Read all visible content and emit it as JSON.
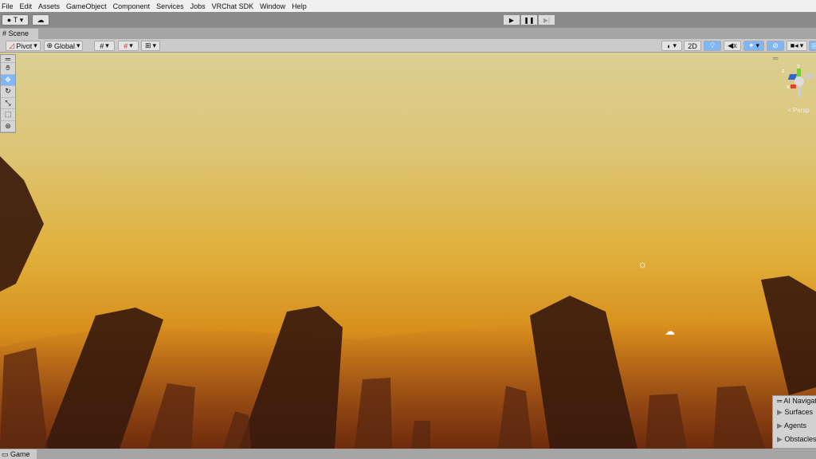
{
  "menu": [
    "File",
    "Edit",
    "Assets",
    "GameObject",
    "Component",
    "Services",
    "Jobs",
    "VRChat SDK",
    "Window",
    "Help"
  ],
  "toolbar": {
    "account_label": "T",
    "play_icon": "play-icon",
    "pause_icon": "pause-icon",
    "step_icon": "step-icon"
  },
  "tabs": {
    "scene": "Scene",
    "game": "Game"
  },
  "scene_toolbar": {
    "pivot": "Pivot",
    "global": "Global",
    "mode_2d": "2D"
  },
  "gizmo": {
    "x": "x",
    "y": "y",
    "z": "z",
    "projection": "Persp"
  },
  "ai_nav": {
    "title": "AI Navigation",
    "items": [
      "Surfaces",
      "Agents",
      "Obstacles"
    ]
  },
  "colors": {
    "active_blue": "#7fb6f5",
    "sky_top": "#dccf93",
    "sky_bottom": "#d88f1c"
  }
}
